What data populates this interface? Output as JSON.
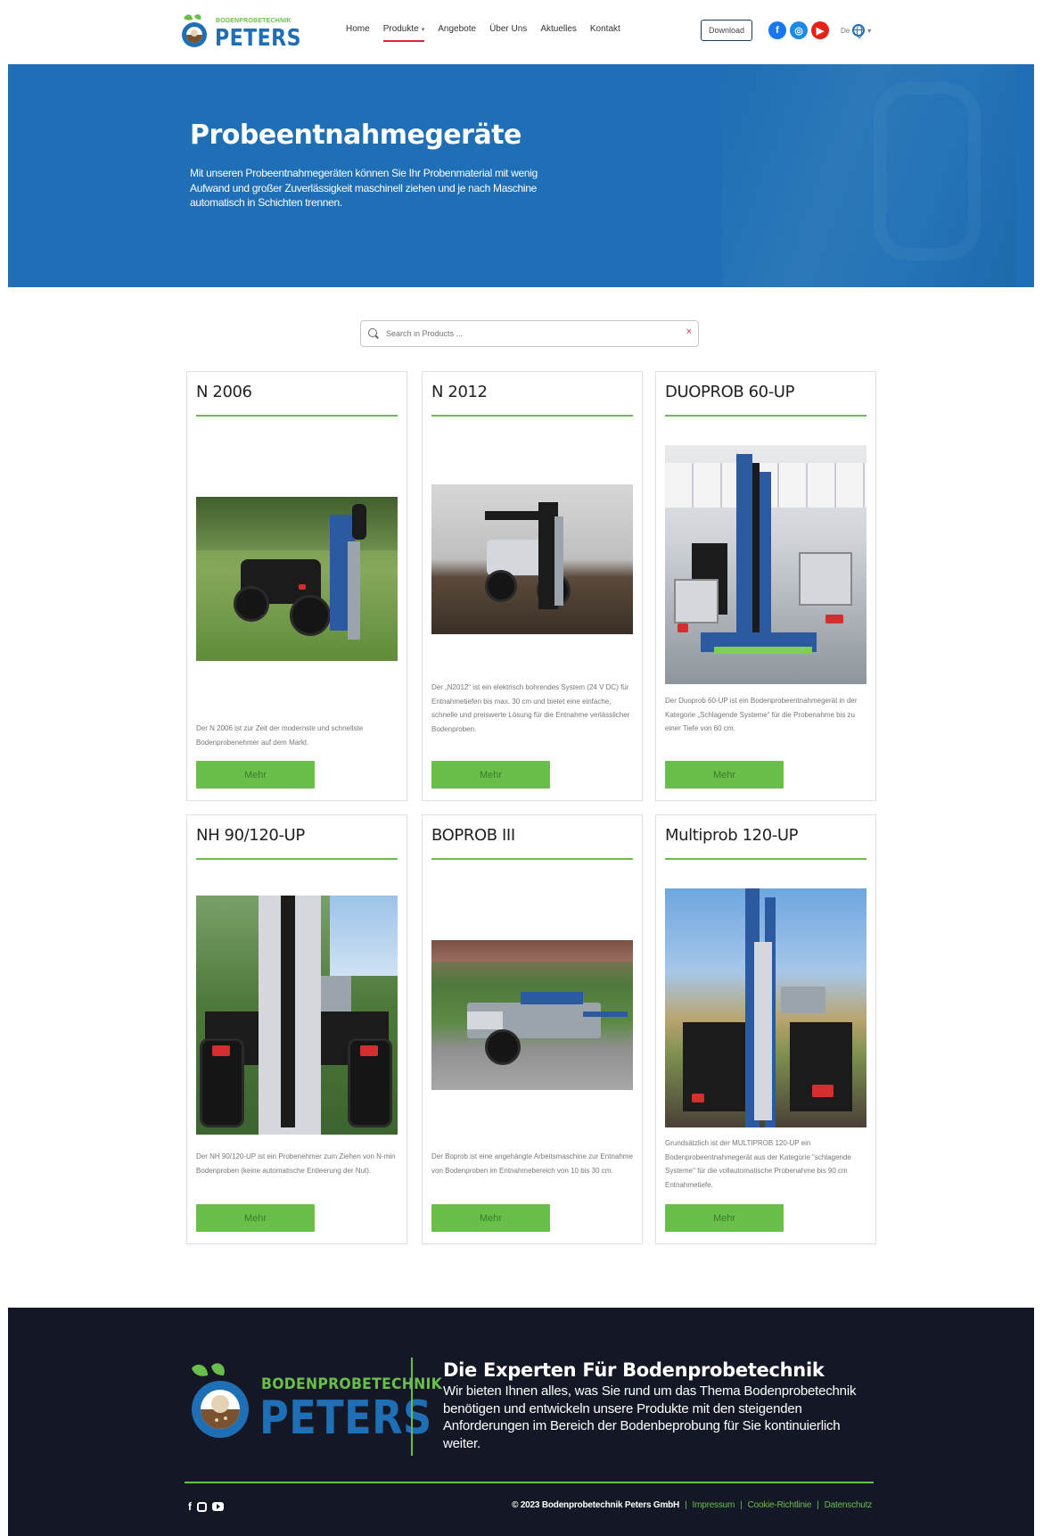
{
  "header": {
    "logo_small": "BODENPROBETECHNIK",
    "logo_big": "PETERS",
    "nav": [
      {
        "label": "Home"
      },
      {
        "label": "Produkte"
      },
      {
        "label": "Angebote"
      },
      {
        "label": "Über Uns"
      },
      {
        "label": "Aktuelles"
      },
      {
        "label": "Kontakt"
      }
    ],
    "download_label": "Download",
    "lang_label": "De"
  },
  "hero": {
    "title": "Probeentnahmegeräte",
    "text": "Mit unseren Probeentnahmegeräten können Sie Ihr Probenmaterial mit wenig Aufwand und großer Zuverlässigkeit maschinell ziehen und je nach Maschine automatisch in Schichten trennen."
  },
  "search": {
    "placeholder": "Search in Products ...",
    "clear_symbol": "×"
  },
  "products": [
    {
      "name": "N 2006",
      "desc": "Der N 2006 ist zur Zeit der modernste und schnellste Bodenprobenehmer auf dem Markt.",
      "button": "Mehr"
    },
    {
      "name": "N 2012",
      "desc": "Der „N2012“ ist ein elektrisch bohrendes System (24 V DC) für Entnahmetiefen bis max. 30 cm und bietet eine einfache, schnelle und preiswerte Lösung für die Entnahme verlässlicher Bodenproben.",
      "button": "Mehr"
    },
    {
      "name": "DUOPROB 60-UP",
      "desc": "Der Duoprob 60-UP ist ein Bodenprobeentnahmegerät in der Kategorie „Schlagende Systeme“ für die Probenahme bis zu einer Tiefe von 60 cm.",
      "button": "Mehr"
    },
    {
      "name": "NH 90/120-UP",
      "desc": "Der NH 90/120-UP ist ein Probenehmer zum Ziehen von N-min Bodenproben (keine automatische Entleerung der Nut).",
      "button": "Mehr"
    },
    {
      "name": "BOPROB III",
      "desc": "Der Boprob ist eine angehängte Arbeitsmaschine zur Entnahme von Bodenproben im Entnahmebereich von 10 bis 30 cm.",
      "button": "Mehr"
    },
    {
      "name": "Multiprob 120-UP",
      "desc": "Grundsätzlich ist der MULTIPROB 120-UP ein Bodenprobeentnahmegerät aus der Kategorie \"schlagende Systeme\" für die vollautomatische Probenahme bis 90 cm Entnahmetiefe.",
      "button": "Mehr"
    }
  ],
  "footer": {
    "logo_small": "BODENPROBETECHNIK",
    "logo_big": "PETERS",
    "heading": "Die Experten Für Bodenprobetechnik",
    "text": "Wir bieten Ihnen alles, was Sie rund um das Thema Bodenprobetechnik benötigen und entwickeln unsere Produkte mit den steigenden Anforderungen im Bereich der Bodenbeprobung für Sie kontinuierlich weiter.",
    "copyright": "© 2023 Bodenprobetechnik Peters GmbH",
    "links": [
      {
        "label": "Impressum"
      },
      {
        "label": "Cookie-Richtlinie"
      },
      {
        "label": "Datenschutz"
      }
    ],
    "separator": "|"
  },
  "colors": {
    "brand_blue": "#1e6fb5",
    "brand_green": "#6abf4b",
    "footer_bg": "#141826",
    "active_nav": "#d7263d"
  },
  "icons": [
    "logo-mark",
    "chevron-down-icon",
    "facebook-icon",
    "instagram-icon",
    "youtube-icon",
    "globe-icon",
    "search-icon",
    "close-icon"
  ]
}
